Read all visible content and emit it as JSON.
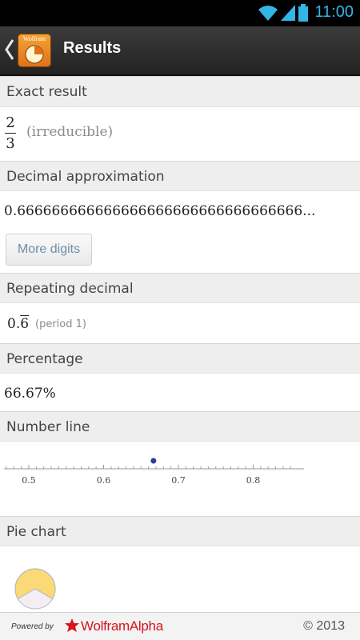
{
  "status_bar": {
    "time": "11:00",
    "icons": [
      "wifi-icon",
      "signal-icon",
      "battery-icon"
    ]
  },
  "action_bar": {
    "title": "Results",
    "app_icon_text": "Wolfram"
  },
  "pods": {
    "exact_result": {
      "header": "Exact result",
      "numerator": "2",
      "denominator": "3",
      "note": "(irreducible)"
    },
    "decimal_approximation": {
      "header": "Decimal approximation",
      "value": "0.666666666666666666666666666666666...",
      "button": "More digits"
    },
    "repeating_decimal": {
      "header": "Repeating decimal",
      "integer": "0.",
      "repeat_digit": "6",
      "note": "(period 1)"
    },
    "percentage": {
      "header": "Percentage",
      "value": "66.67%"
    },
    "number_line": {
      "header": "Number line",
      "tick_labels": [
        "0.5",
        "0.6",
        "0.7",
        "0.8"
      ],
      "point_value": 0.6667
    },
    "pie_chart": {
      "header": "Pie chart",
      "fraction": 0.6667
    }
  },
  "footer": {
    "powered_by": "Powered by",
    "brand": "WolframAlpha",
    "copyright": "© 2013"
  },
  "colors": {
    "accent_blue": "#33b5e5",
    "header_bg": "#eeeeee",
    "pie_fill": "#fbd878",
    "pie_rest": "#f3eef4",
    "point": "#2a3f8f",
    "brand_red": "#d6141f"
  }
}
